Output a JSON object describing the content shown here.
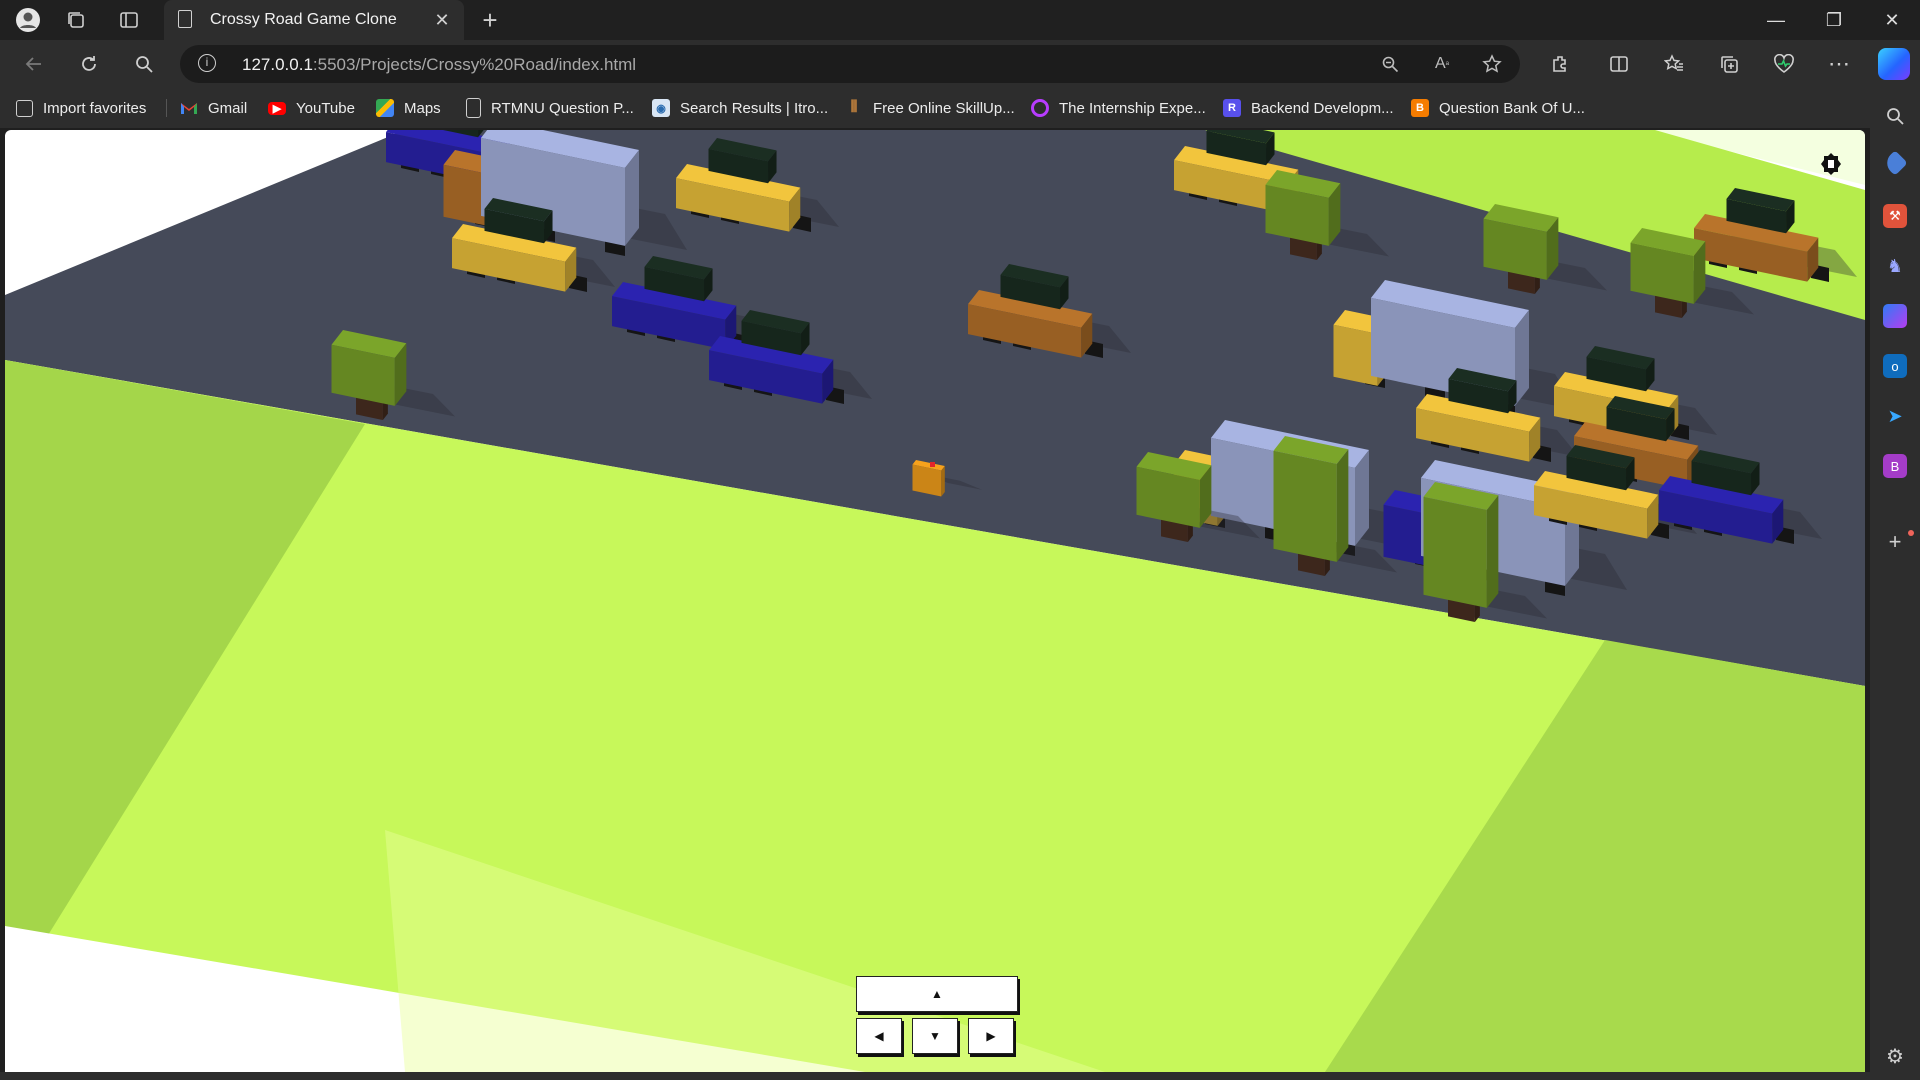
{
  "browser": {
    "tab_title": "Crossy Road Game Clone",
    "tab_close": "✕",
    "new_tab": "+",
    "url_host": "127.0.0.1",
    "url_rest": ":5503/Projects/Crossy%20Road/index.html",
    "window_controls": {
      "minimize": "—",
      "restore": "❐",
      "close": "✕"
    }
  },
  "favorites": [
    {
      "label": "Import favorites",
      "icon": "import-icon",
      "color": "#3a3a3a"
    },
    {
      "label": "Gmail",
      "icon": "gmail-icon",
      "color": "#ea4335"
    },
    {
      "label": "YouTube",
      "icon": "youtube-icon",
      "color": "#ff0000"
    },
    {
      "label": "Maps",
      "icon": "maps-icon",
      "color": "#34a853"
    },
    {
      "label": "RTMNU Question P...",
      "icon": "page-icon",
      "color": "#3a3a3a"
    },
    {
      "label": "Search Results | Itro...",
      "icon": "itro-icon",
      "color": "#2b6cb0"
    },
    {
      "label": "Free Online SkillUp...",
      "icon": "skillup-icon",
      "color": "#c0803c"
    },
    {
      "label": "The Internship Expe...",
      "icon": "internship-icon",
      "color": "#b83cff"
    },
    {
      "label": "Backend Developm...",
      "icon": "backend-icon",
      "color": "#5850ec",
      "letter": "R"
    },
    {
      "label": "Question Bank Of U...",
      "icon": "blogger-icon",
      "color": "#f57c00",
      "letter": "B"
    }
  ],
  "game": {
    "controls": {
      "up": "▲",
      "left": "◀",
      "down": "▼",
      "right": "▶"
    },
    "colors": {
      "grass": "#c4f55a",
      "grass_side": "#a9dc4c",
      "road": "#454a59",
      "tree_leaves": "#7ba52a",
      "tree_trunk": "#4a2f22",
      "car_yellow": "#f2c53d",
      "car_blue": "#2b23b0",
      "car_orange": "#b9742b",
      "truck_cargo": "#a8b4e2",
      "chicken": "#f7a21c"
    }
  }
}
